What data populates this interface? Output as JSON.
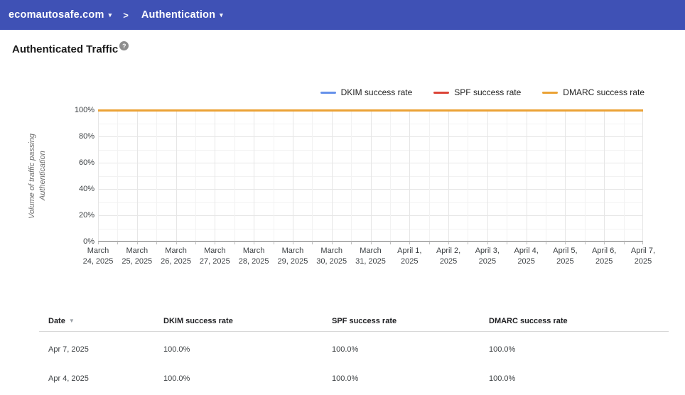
{
  "colors": {
    "topbar_bg": "#3F51B5",
    "dkim": "#6691EA",
    "spf": "#DB4437",
    "dmarc": "#EBA235",
    "grid_major": "#e6e6e6",
    "grid_minor": "#f2f2f2",
    "axis": "#757575"
  },
  "topbar": {
    "domain": "ecomautosafe.com",
    "caret": "▾",
    "separator": ">",
    "section": "Authentication"
  },
  "page": {
    "title": "Authenticated Traffic",
    "help_icon": "?"
  },
  "chart_data": {
    "type": "line",
    "title": "",
    "xlabel": "",
    "ylabel": "Volume of traffic passing Authentication",
    "ylabel_lines": [
      "Volume of traffic passing",
      "Authentication"
    ],
    "ylim": [
      0,
      100
    ],
    "y_ticks": [
      "100%",
      "80%",
      "60%",
      "40%",
      "20%",
      "0%"
    ],
    "grid": true,
    "legend_position": "top-right",
    "categories": [
      "March 24, 2025",
      "March 25, 2025",
      "March 26, 2025",
      "March 27, 2025",
      "March 28, 2025",
      "March 29, 2025",
      "March 30, 2025",
      "March 31, 2025",
      "April 1, 2025",
      "April 2, 2025",
      "April 3, 2025",
      "April 4, 2025",
      "April 5, 2025",
      "April 6, 2025",
      "April 7, 2025"
    ],
    "x_labels": [
      [
        "March",
        "24, 2025"
      ],
      [
        "March",
        "25, 2025"
      ],
      [
        "March",
        "26, 2025"
      ],
      [
        "March",
        "27, 2025"
      ],
      [
        "March",
        "28, 2025"
      ],
      [
        "March",
        "29, 2025"
      ],
      [
        "March",
        "30, 2025"
      ],
      [
        "March",
        "31, 2025"
      ],
      [
        "April 1,",
        "2025"
      ],
      [
        "April 2,",
        "2025"
      ],
      [
        "April 3,",
        "2025"
      ],
      [
        "April 4,",
        "2025"
      ],
      [
        "April 5,",
        "2025"
      ],
      [
        "April 6,",
        "2025"
      ],
      [
        "April 7,",
        "2025"
      ]
    ],
    "series": [
      {
        "name": "DKIM success rate",
        "color": "#6691EA",
        "thickness": 2,
        "values": [
          100,
          100,
          100,
          100,
          100,
          100,
          100,
          100,
          100,
          100,
          100,
          100,
          100,
          100,
          100
        ]
      },
      {
        "name": "SPF success rate",
        "color": "#DB4437",
        "thickness": 2,
        "values": [
          100,
          100,
          100,
          100,
          100,
          100,
          100,
          100,
          100,
          100,
          100,
          100,
          100,
          100,
          100
        ]
      },
      {
        "name": "DMARC success rate",
        "color": "#EBA235",
        "thickness": 3,
        "values": [
          100,
          100,
          100,
          100,
          100,
          100,
          100,
          100,
          100,
          100,
          100,
          100,
          100,
          100,
          100
        ]
      }
    ]
  },
  "table": {
    "columns": [
      "Date",
      "DKIM success rate",
      "SPF success rate",
      "DMARC success rate"
    ],
    "sort": {
      "column": "Date",
      "direction": "desc",
      "icon": "▼"
    },
    "rows": [
      [
        "Apr 7, 2025",
        "100.0%",
        "100.0%",
        "100.0%"
      ],
      [
        "Apr 4, 2025",
        "100.0%",
        "100.0%",
        "100.0%"
      ]
    ]
  }
}
